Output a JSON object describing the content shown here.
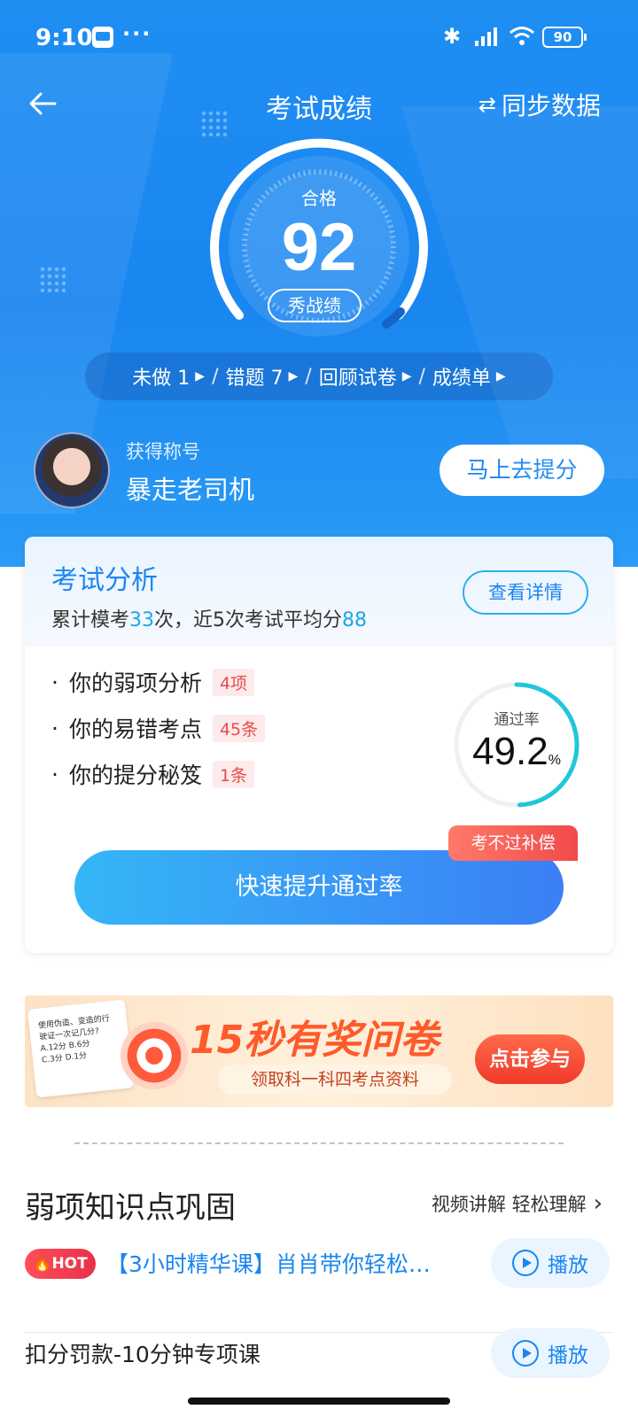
{
  "status_bar": {
    "time": "9:10",
    "more": "···",
    "battery": "90"
  },
  "nav": {
    "title": "考试成绩",
    "sync_label": "同步数据",
    "sync_icon": "⇄"
  },
  "score": {
    "pass_label": "合格",
    "value": "92",
    "show_label": "秀战绩"
  },
  "actions": [
    {
      "label": "未做 1"
    },
    {
      "label": "错题  7"
    },
    {
      "label": "回顾试卷"
    },
    {
      "label": "成绩单"
    }
  ],
  "profile": {
    "title_label": "获得称号",
    "title_value": "暴走老司机",
    "improve_button": "马上去提分"
  },
  "analysis": {
    "title": "考试分析",
    "summary_prefix": "累计模考",
    "summary_count": "33",
    "summary_middle": "次，近5次考试平均分",
    "summary_avg": "88",
    "detail_button": "查看详情",
    "items": [
      {
        "label": "你的弱项分析",
        "badge": "4项"
      },
      {
        "label": "你的易错考点",
        "badge": "45条"
      },
      {
        "label": "你的提分秘笈",
        "badge": "1条"
      }
    ],
    "rate_label": "通过率",
    "rate_value": "49.2",
    "rate_unit": "%",
    "compensation_tag": "考不过补偿",
    "boost_button": "快速提升通过率"
  },
  "banner": {
    "title": "15秒有奖问卷",
    "subtitle": "领取科一科四考点资料",
    "cta": "点击参与",
    "paper_text": "使用伪造、变造的行\n驶证一次记几分?\nA.12分  B.6分\nC.3分   D.1分"
  },
  "section": {
    "title": "弱项知识点巩固",
    "more": "视频讲解 轻松理解"
  },
  "courses": [
    {
      "hot": "HOT",
      "title": "【3小时精华课】肖肖带你轻松…",
      "play": "播放"
    },
    {
      "title": "扣分罚款-10分钟专项课",
      "play": "播放"
    }
  ],
  "colors": {
    "brand": "#1a86f0",
    "accent": "#1aa6e8",
    "danger": "#e84b4b",
    "hot": "#e8304a"
  }
}
